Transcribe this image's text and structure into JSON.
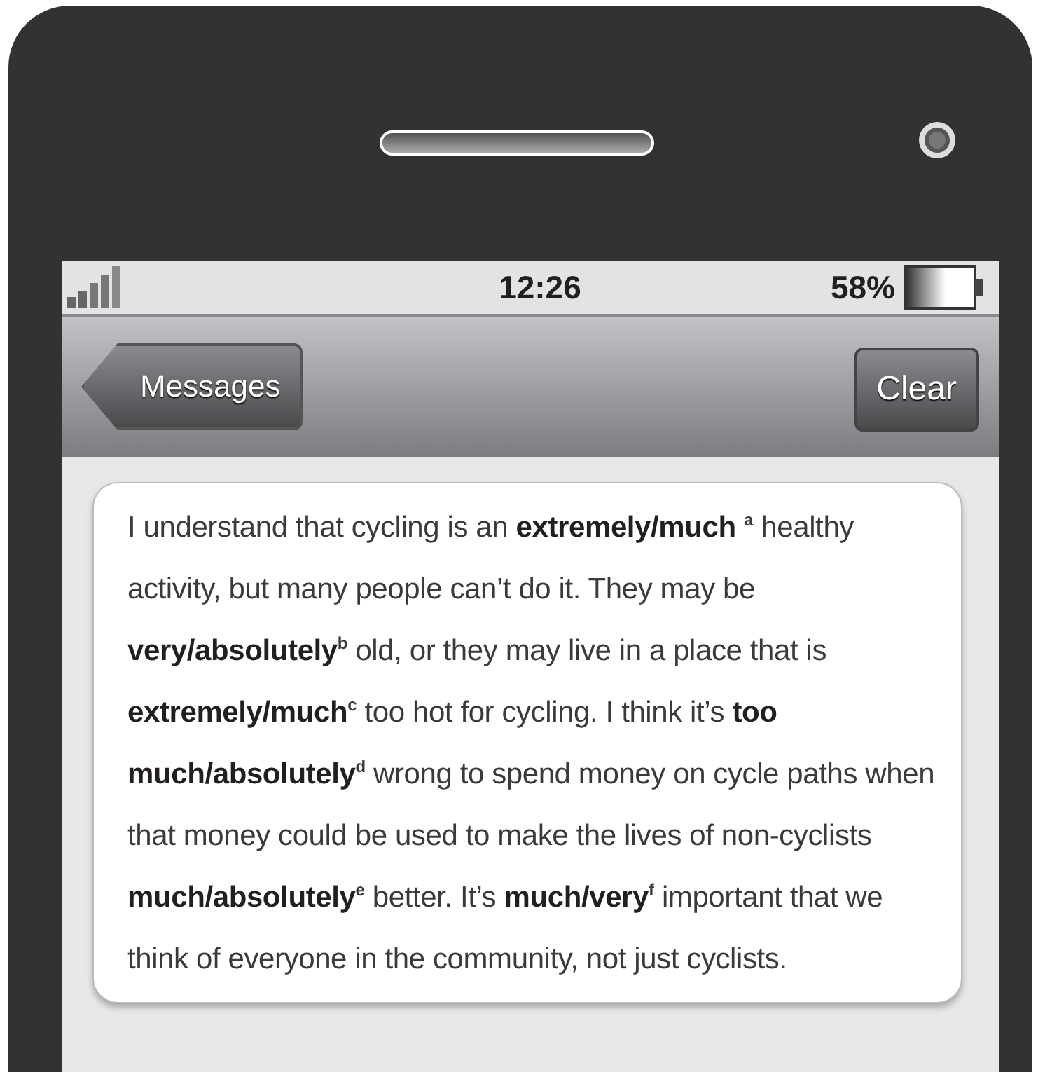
{
  "status_bar": {
    "time": "12:26",
    "battery": "58%"
  },
  "nav_bar": {
    "back_button": "Messages",
    "action_button": "Clear"
  },
  "message": "I understand that cycling is an **extremely/much** $^{a}$ healthy activity, but many people can’t do it. They may be **very/absolutely**$^{b}$ old, or they may live in a place that is **extremely/much**$^{c}$ too hot for cycling. I think it’s **too much/absolutely**$^{d}$ wrong to spend money on cycle paths when that money could be used to make the lives of non-cyclists **much/absolutely**$^{e}$ better. It’s **much/very**$^{f}$ important that we think of everyone in the community, not just cyclists."
}
